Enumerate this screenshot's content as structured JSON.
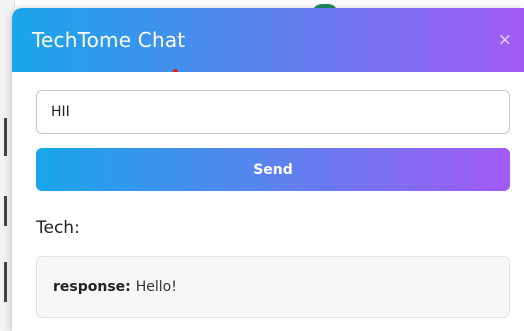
{
  "chat": {
    "title": "TechTome Chat",
    "close_label": "×",
    "input_value": "HII",
    "send_label": "Send",
    "sender_label": "Tech:",
    "response_key": "response:",
    "response_text": "Hello!"
  },
  "colors": {
    "gradient_start": "#19a6ea",
    "gradient_mid": "#5b82ee",
    "gradient_end": "#a25af6",
    "indicator_dot": "#e21b1b"
  }
}
